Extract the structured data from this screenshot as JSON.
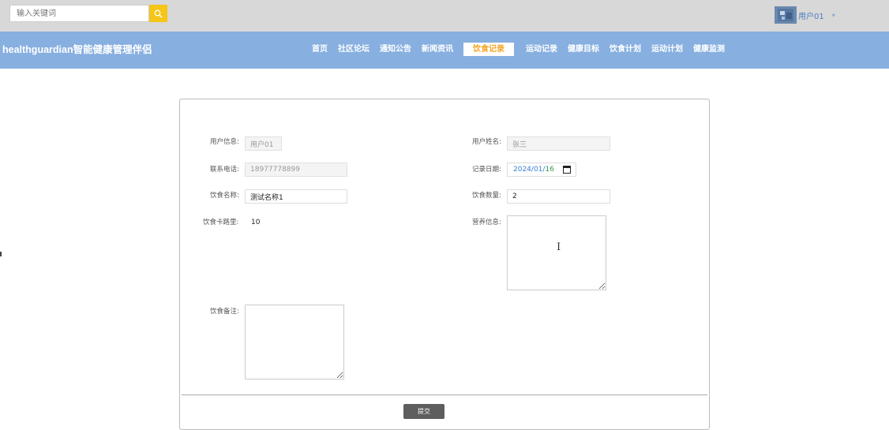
{
  "search": {
    "placeholder": "输入关键词"
  },
  "user": {
    "name": "用户01",
    "caret": "▾"
  },
  "brand": "healthguardian智能健康管理伴侣",
  "nav": [
    {
      "label": "首页"
    },
    {
      "label": "社区论坛"
    },
    {
      "label": "通知公告"
    },
    {
      "label": "新闻资讯"
    },
    {
      "label": "饮食记录",
      "active": true
    },
    {
      "label": "运动记录"
    },
    {
      "label": "健康目标"
    },
    {
      "label": "饮食计划"
    },
    {
      "label": "运动计划"
    },
    {
      "label": "健康监测"
    }
  ],
  "form": {
    "user_info_label": "用户信息:",
    "user_info_value": "用户01",
    "user_realname_label": "用户姓名:",
    "user_realname_value": "张三",
    "phone_label": "联系电话:",
    "phone_value": "18977778899",
    "record_date_label": "记录日期:",
    "record_date": {
      "year": "2024",
      "month": "01",
      "day": "16",
      "sep": "/"
    },
    "food_name_label": "饮食名称:",
    "food_name_value": "测试名称1",
    "food_qty_label": "饮食数量:",
    "food_qty_value": "2",
    "calories_label": "饮食卡路里:",
    "calories_value": "10",
    "nutrition_label": "营养信息:",
    "remark_label": "饮食备注:",
    "submit_label": "提交"
  },
  "colors": {
    "topbar": "#d8d8d8",
    "navbar": "#87afe0",
    "search_button": "#f5c518",
    "nav_active_text": "#f5a623",
    "submit_button": "#5e5e5e"
  },
  "icons": [
    "search-icon",
    "avatar-icon",
    "calendar-icon",
    "text-cursor-icon"
  ]
}
